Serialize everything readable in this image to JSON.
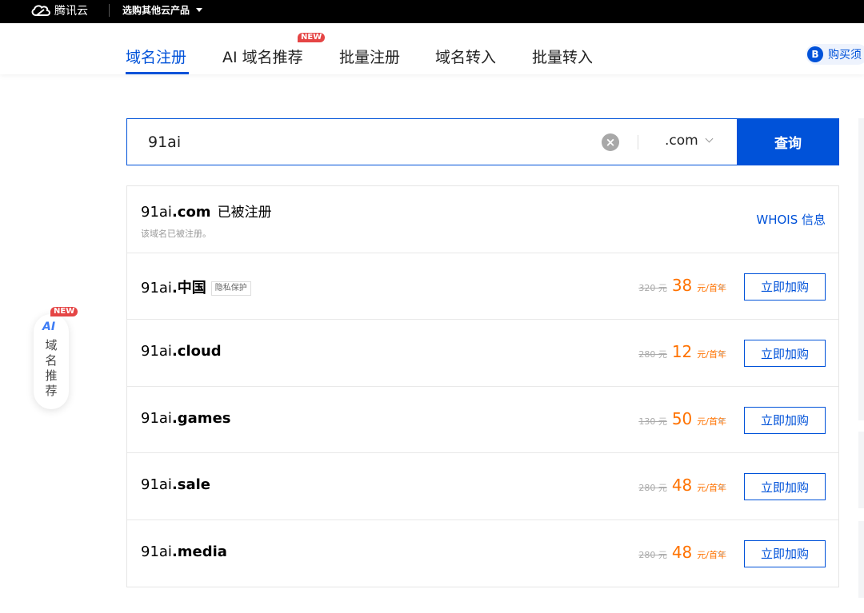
{
  "topbar": {
    "logo_text": "腾讯云",
    "other_products": "选购其他云产品"
  },
  "tabs": [
    {
      "label": "域名注册",
      "active": true
    },
    {
      "label": "AI 域名推荐",
      "badge": "NEW"
    },
    {
      "label": "批量注册"
    },
    {
      "label": "域名转入"
    },
    {
      "label": "批量转入"
    }
  ],
  "purchase_guide": {
    "icon_letter": "B",
    "label": "购买须"
  },
  "search": {
    "value": "91ai",
    "tld": ".com",
    "button": "查询"
  },
  "registered": {
    "name": "91ai",
    "tld": ".com",
    "status": "已被注册",
    "note": "该域名已被注册。",
    "whois": "WHOIS 信息"
  },
  "results": [
    {
      "name": "91ai",
      "tld": ".中国",
      "tag": "隐私保护",
      "old_price": "320 元",
      "price": "38",
      "unit": "元/首年",
      "button": "立即加购"
    },
    {
      "name": "91ai",
      "tld": ".cloud",
      "old_price": "280 元",
      "price": "12",
      "unit": "元/首年",
      "button": "立即加购"
    },
    {
      "name": "91ai",
      "tld": ".games",
      "old_price": "130 元",
      "price": "50",
      "unit": "元/首年",
      "button": "立即加购"
    },
    {
      "name": "91ai",
      "tld": ".sale",
      "old_price": "280 元",
      "price": "48",
      "unit": "元/首年",
      "button": "立即加购"
    },
    {
      "name": "91ai",
      "tld": ".media",
      "old_price": "280 元",
      "price": "48",
      "unit": "元/首年",
      "button": "立即加购"
    }
  ],
  "ai_float": {
    "badge": "NEW",
    "logo": "AI",
    "text": "域名推荐"
  },
  "colors": {
    "brand": "#0052d9",
    "price": "#ff7200",
    "badge": "#e54545"
  }
}
